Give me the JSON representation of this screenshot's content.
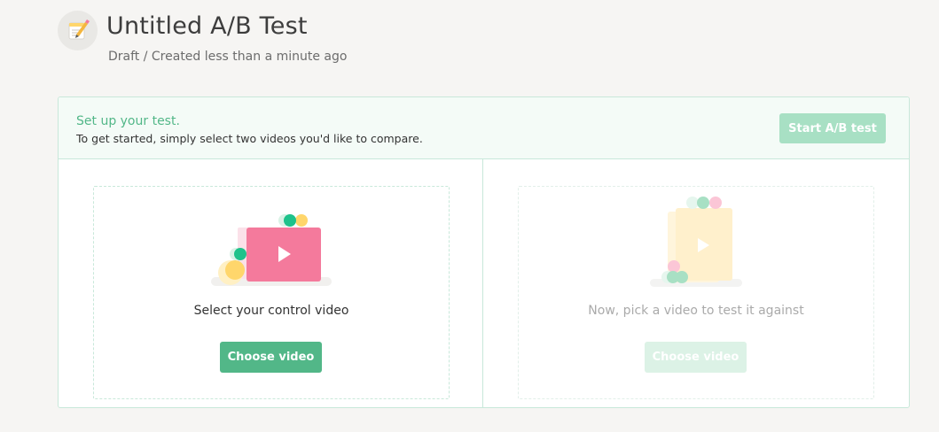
{
  "header": {
    "icon": "pencil-notepad-icon",
    "title": "Untitled A/B Test",
    "subtitle": "Draft / Created less than a minute ago"
  },
  "banner": {
    "title": "Set up your test.",
    "text": "To get started, simply select two videos you'd like to compare.",
    "start_button": "Start A/B test"
  },
  "slots": {
    "control": {
      "label": "Select your control video",
      "button": "Choose video",
      "icon": "video-play-icon"
    },
    "variant": {
      "label": "Now, pick a video to test it against",
      "button": "Choose video",
      "icon": "video-play-icon"
    }
  },
  "colors": {
    "accent": "#52b788",
    "accent_light": "#a8e0c4",
    "video_pink": "#f47a9c",
    "video_yellow": "#fff0cc",
    "background": "#f6f5f3"
  }
}
